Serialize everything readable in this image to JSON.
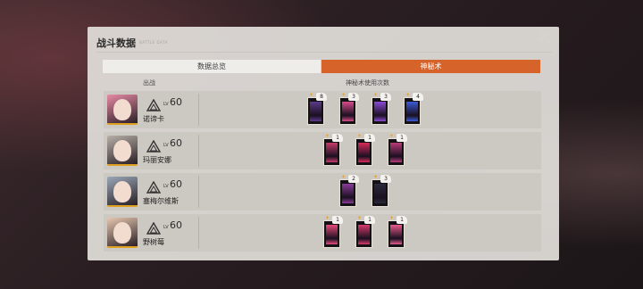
{
  "panel": {
    "title": "战斗数据",
    "subtitle": "BATTLE DATA",
    "close_glyph": "✕"
  },
  "tabs": [
    {
      "label": "数据总览",
      "active": false
    },
    {
      "label": "神秘术",
      "active": true
    }
  ],
  "columns": {
    "out": "出战",
    "usage": "神秘术使用次数"
  },
  "colors": {
    "accent": "#d6642a",
    "panel": "#e2dfda",
    "row": "#ccc8c2",
    "card_border": "#e7e1d8"
  },
  "characters": [
    {
      "name": "诺谛卡",
      "lv_label": "LV",
      "level": "60",
      "rank_icon": "rank-insight-icon",
      "avatar_color": "#e88aa6",
      "cards": [
        {
          "count": "8",
          "art_color": "#5b3a8a"
        },
        {
          "count": "3",
          "art_color": "#d84a8a"
        },
        {
          "count": "3",
          "art_color": "#8a4ad8"
        },
        {
          "count": "4",
          "art_color": "#3a5ad8"
        }
      ]
    },
    {
      "name": "玛丽安娜",
      "lv_label": "LV",
      "level": "60",
      "rank_icon": "rank-insight-icon",
      "avatar_color": "#b8b0a8",
      "cards": [
        {
          "count": "1",
          "art_color": "#c83a6a"
        },
        {
          "count": "1",
          "art_color": "#d82a5a"
        },
        {
          "count": "1",
          "art_color": "#b83a7a"
        }
      ]
    },
    {
      "name": "塞梅尔维斯",
      "lv_label": "LV",
      "level": "60",
      "rank_icon": "rank-insight-icon",
      "avatar_color": "#9aa8b8",
      "cards": [
        {
          "count": "2",
          "art_color": "#8a3a9a"
        },
        {
          "count": "3",
          "art_color": "#2a2a3a"
        }
      ]
    },
    {
      "name": "野树莓",
      "lv_label": "LV",
      "level": "60",
      "rank_icon": "rank-insight-icon",
      "avatar_color": "#e8c8b0",
      "cards": [
        {
          "count": "1",
          "art_color": "#e84a7a"
        },
        {
          "count": "1",
          "art_color": "#d83a6a"
        },
        {
          "count": "1",
          "art_color": "#e85a8a"
        }
      ]
    }
  ]
}
